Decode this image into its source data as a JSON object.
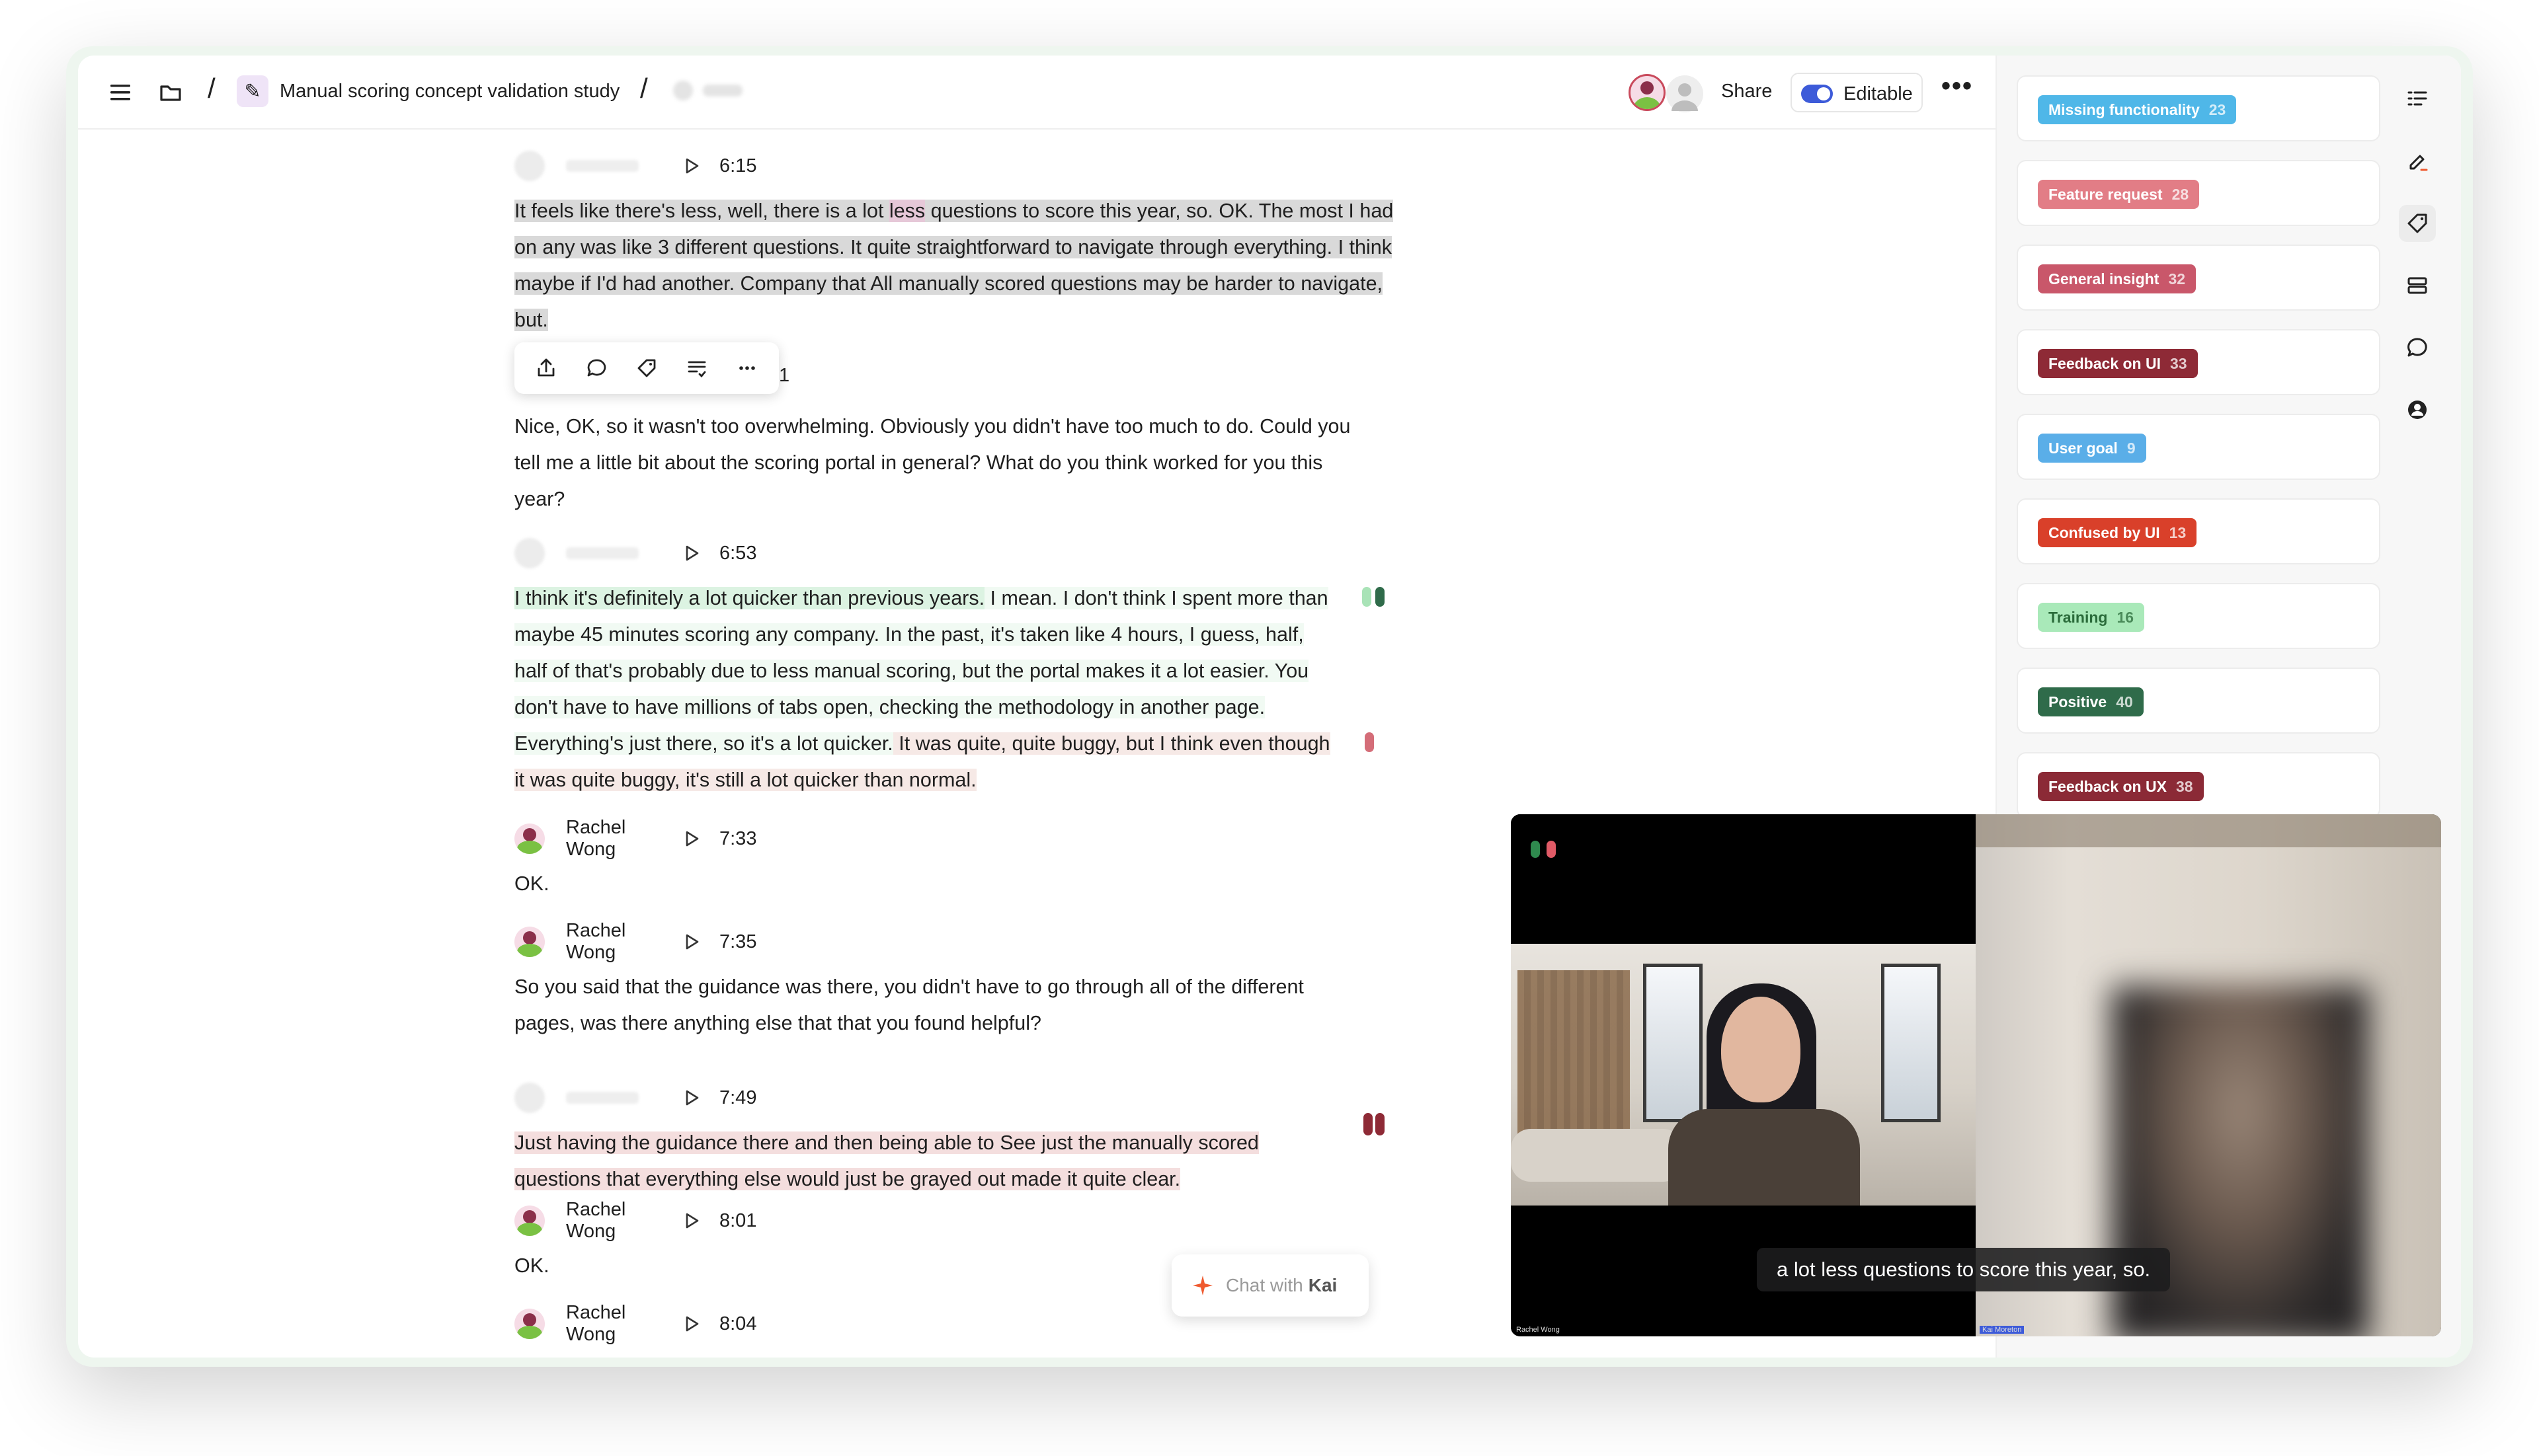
{
  "header": {
    "doc_title": "Manual scoring concept validation study",
    "share_label": "Share",
    "editable_label": "Editable"
  },
  "transcript": {
    "blocks": [
      {
        "speaker": "",
        "time": "6:15",
        "text_parts": [
          "It feels like there's less, well, there is a lot ",
          "less",
          " questions to score this year, so. OK. The most I had on any was like 3 different questions. It quite straightforward to navigate through everything. I think maybe if I'd had another. Company that All manually scored questions may be harder to navigate, but."
        ]
      },
      {
        "speaker": "",
        "time": "1",
        "text": "Nice, OK, so it wasn't too overwhelming. Obviously you didn't have too much to do. Could you tell me a little bit about the scoring portal in general? What do you think worked for you this year?"
      },
      {
        "speaker": "",
        "time": "6:53",
        "text_parts": [
          "I think it's definitely a lot quicker than previous years.",
          " I mean. I don't think I spent more than maybe 45 minutes scoring any company. In the past, it's taken like 4 hours, I guess, half, half of that's probably due to less manual scoring, but the portal makes it a lot easier. You don't have to have millions of tabs open, checking the methodology in another page. Everything's just there, so it's a lot quicker.",
          " It was quite, quite buggy, but I think even though it was quite buggy, it's still a lot quicker than normal."
        ]
      },
      {
        "speaker": "Rachel Wong",
        "time": "7:33",
        "text": "OK."
      },
      {
        "speaker": "Rachel Wong",
        "time": "7:35",
        "text": "So you said that the guidance was there, you didn't have to go through all of the different pages, was there anything else that that you found helpful?"
      },
      {
        "speaker": "",
        "time": "7:49",
        "text": "Just having the guidance there and then being able to See just the manually scored questions that everything else would just be grayed out made it quite clear."
      },
      {
        "speaker": "Rachel Wong",
        "time": "8:01",
        "text": "OK."
      },
      {
        "speaker": "Rachel Wong",
        "time": "8:04",
        "text": ""
      }
    ]
  },
  "toolbar_icons": [
    "share-icon",
    "comment-icon",
    "tag-icon",
    "highlight-list-icon",
    "more-icon"
  ],
  "tags": [
    {
      "label": "Missing functionality",
      "count": "23",
      "color": "#4fb7e8"
    },
    {
      "label": "Feature request",
      "count": "28",
      "color": "#e27d86"
    },
    {
      "label": "General insight",
      "count": "32",
      "color": "#c9576a"
    },
    {
      "label": "Feedback on UI",
      "count": "33",
      "color": "#8e2a36"
    },
    {
      "label": "User goal",
      "count": "9",
      "color": "#5aaee8"
    },
    {
      "label": "Confused by UI",
      "count": "13",
      "color": "#d9402a"
    },
    {
      "label": "Training",
      "count": "16",
      "color": "#a9e9b9",
      "text_color": "#2a6b3a"
    },
    {
      "label": "Positive",
      "count": "40",
      "color": "#2f6b4a"
    },
    {
      "label": "Feedback on UX",
      "count": "38",
      "color": "#8b2a36"
    }
  ],
  "side_icons": [
    "list-icon",
    "highlighter-icon",
    "tag-icon",
    "cards-icon",
    "comment-icon",
    "user-icon"
  ],
  "video": {
    "caption": "a lot less questions to score this year, so.",
    "left_tile_label": "Rachel Wong",
    "right_tile_label": "Kai Moreton"
  },
  "chat": {
    "prefix": "Chat with",
    "name": "Kai"
  },
  "colors": {
    "accent": "#3d5bd9",
    "marker_green_light": "#a9e3b7",
    "marker_green_dark": "#2f6b4a",
    "marker_pink": "#d46d78",
    "marker_maroon": "#8e2a36"
  }
}
